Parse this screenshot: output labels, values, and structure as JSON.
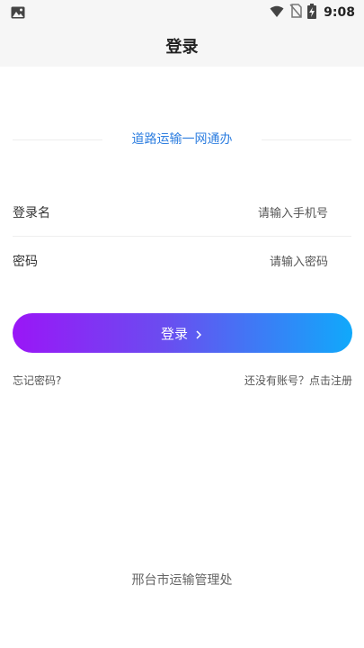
{
  "status": {
    "time": "9:08",
    "left_icon": "image-icon",
    "right_icons": [
      "wifi-icon",
      "no-sim-icon",
      "battery-charging-icon"
    ]
  },
  "header": {
    "title": "登录"
  },
  "slogan": "道路运输一网通办",
  "form": {
    "username_label": "登录名",
    "username_placeholder": "请输入手机号",
    "password_label": "密码",
    "password_placeholder": "请输入密码"
  },
  "login_button": {
    "label": "登录"
  },
  "links": {
    "forgot": "忘记密码?",
    "register": "还没有账号？点击注册"
  },
  "footer": "邢台市运输管理处",
  "colors": {
    "accent_blue": "#2f7fe0",
    "gradient_start": "#9a16f7",
    "gradient_end": "#10a9fb"
  }
}
